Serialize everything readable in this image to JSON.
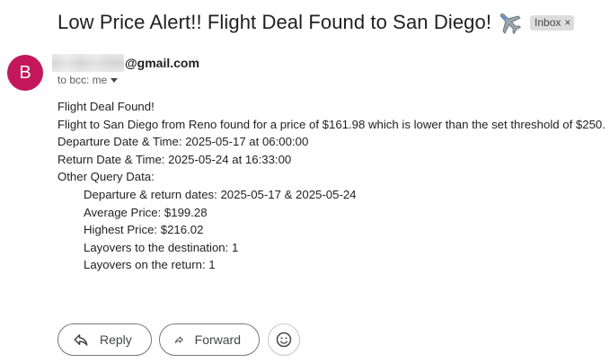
{
  "email": {
    "subject": "Low Price Alert!! Flight Deal Found to San Diego!",
    "subject_icon": "airplane-emoji",
    "label_chip": "Inbox",
    "label_close": "×",
    "sender": {
      "avatar_letter": "B",
      "avatar_color": "#c2185b",
      "email_suffix": "@gmail.com"
    },
    "recipients": "to bcc: me",
    "body": {
      "line1": "Flight Deal Found!",
      "line2": "Flight to San Diego from Reno found for a price of $161.98 which is lower than the set threshold of $250.",
      "line3": "Departure Date & Time: 2025-05-17 at 06:00:00",
      "line4": "Return Date & Time: 2025-05-24 at 16:33:00",
      "line5": "Other Query Data:",
      "query_items": [
        "Departure & return dates: 2025-05-17 & 2025-05-24",
        "Average Price: $199.28",
        "Highest Price: $216.02",
        "Layovers to the destination: 1",
        "Layovers on the return: 1"
      ]
    }
  },
  "actions": {
    "reply_label": "Reply",
    "forward_label": "Forward",
    "emoji_icon": "smiley-icon"
  }
}
